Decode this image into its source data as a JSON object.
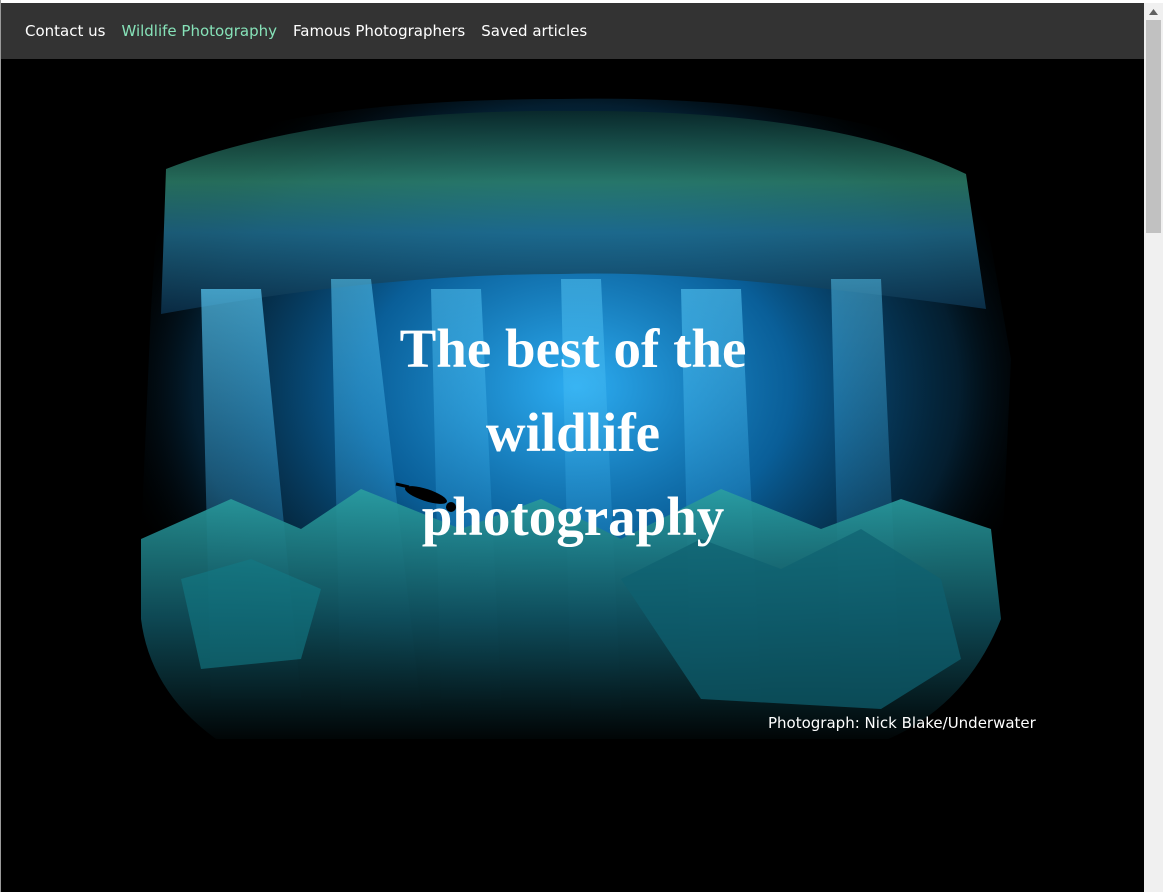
{
  "nav": {
    "items": [
      {
        "label": "Contact us",
        "active": false
      },
      {
        "label": "Wildlife Photography",
        "active": true
      },
      {
        "label": "Famous Photographers",
        "active": false
      },
      {
        "label": "Saved articles",
        "active": false
      }
    ],
    "active_color": "#86e2b8",
    "background": "#333333"
  },
  "hero": {
    "title_line1": "The best of the",
    "title_line2": "wildlife",
    "title_line3": "photography",
    "caption": "Photograph: Nick Blake/Underwater",
    "image_description_icon": "underwater-cave-photo"
  },
  "scrollbar": {
    "up_icon": "chevron-up-icon"
  }
}
